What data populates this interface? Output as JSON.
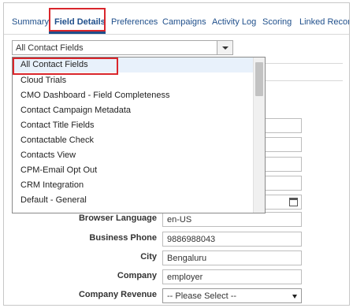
{
  "tabs": [
    {
      "label": "Summary"
    },
    {
      "label": "Field Details"
    },
    {
      "label": "Preferences"
    },
    {
      "label": "Campaigns"
    },
    {
      "label": "Activity Log"
    },
    {
      "label": "Scoring"
    },
    {
      "label": "Linked Records"
    }
  ],
  "active_tab": "Field Details",
  "field_group_select": {
    "value": "All Contact Fields"
  },
  "dropdown": {
    "items": [
      {
        "label": "All Contact Fields"
      },
      {
        "label": "Cloud Trials"
      },
      {
        "label": "CMO Dashboard - Field Completeness"
      },
      {
        "label": "Contact Campaign Metadata"
      },
      {
        "label": "Contact Title Fields"
      },
      {
        "label": "Contactable Check"
      },
      {
        "label": "Contacts View"
      },
      {
        "label": "CPM-Email Opt Out"
      },
      {
        "label": "CRM Integration"
      },
      {
        "label": "Default - General"
      }
    ],
    "selected": "All Contact Fields"
  },
  "fields": {
    "browser_language": {
      "label": "Browser Language",
      "value": "en-US"
    },
    "business_phone": {
      "label": "Business Phone",
      "value": "9886988043"
    },
    "city": {
      "label": "City",
      "value": "Bengaluru"
    },
    "company": {
      "label": "Company",
      "value": "employer"
    },
    "company_revenue": {
      "label": "Company Revenue",
      "value": "-- Please Select --"
    }
  },
  "colors": {
    "link": "#1f4f8b",
    "highlight": "#d9262c",
    "selected_row": "#e8f1fb"
  }
}
